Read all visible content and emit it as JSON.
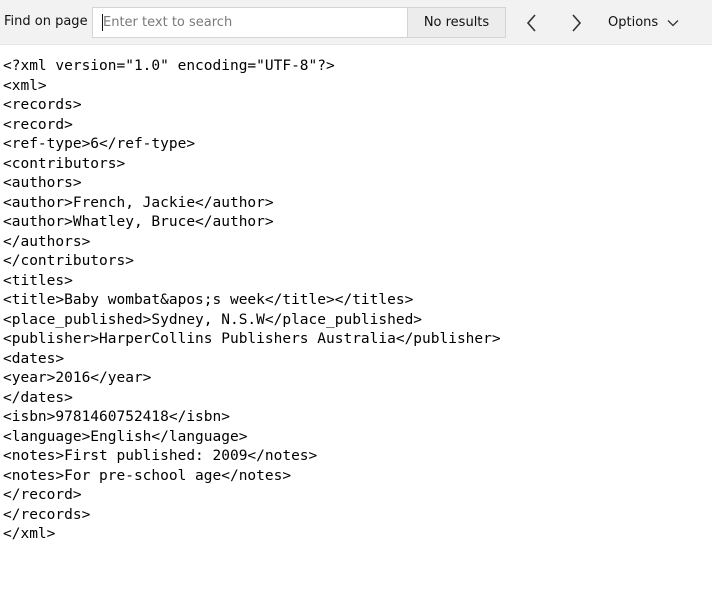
{
  "find_bar": {
    "label": "Find on page",
    "search_placeholder": "Enter text to search",
    "search_value": "",
    "results_text": "No results",
    "options_label": "Options",
    "prev_icon": "chevron-left-icon",
    "next_icon": "chevron-right-icon",
    "options_icon": "chevron-down-icon"
  },
  "document": {
    "lines": [
      "<?xml version=\"1.0\" encoding=\"UTF-8\"?>",
      "<xml>",
      "<records>",
      "<record>",
      "<ref-type>6</ref-type>",
      "<contributors>",
      "<authors>",
      "<author>French, Jackie</author>",
      "<author>Whatley, Bruce</author>",
      "</authors>",
      "</contributors>",
      "<titles>",
      "<title>Baby wombat&apos;s week</title></titles>",
      "<place_published>Sydney, N.S.W</place_published>",
      "<publisher>HarperCollins Publishers Australia</publisher>",
      "<dates>",
      "<year>2016</year>",
      "</dates>",
      "<isbn>9781460752418</isbn>",
      "<language>English</language>",
      "<notes>First published: 2009</notes>",
      "<notes>For pre-school age</notes>",
      "</record>",
      "</records>",
      "</xml>"
    ]
  }
}
